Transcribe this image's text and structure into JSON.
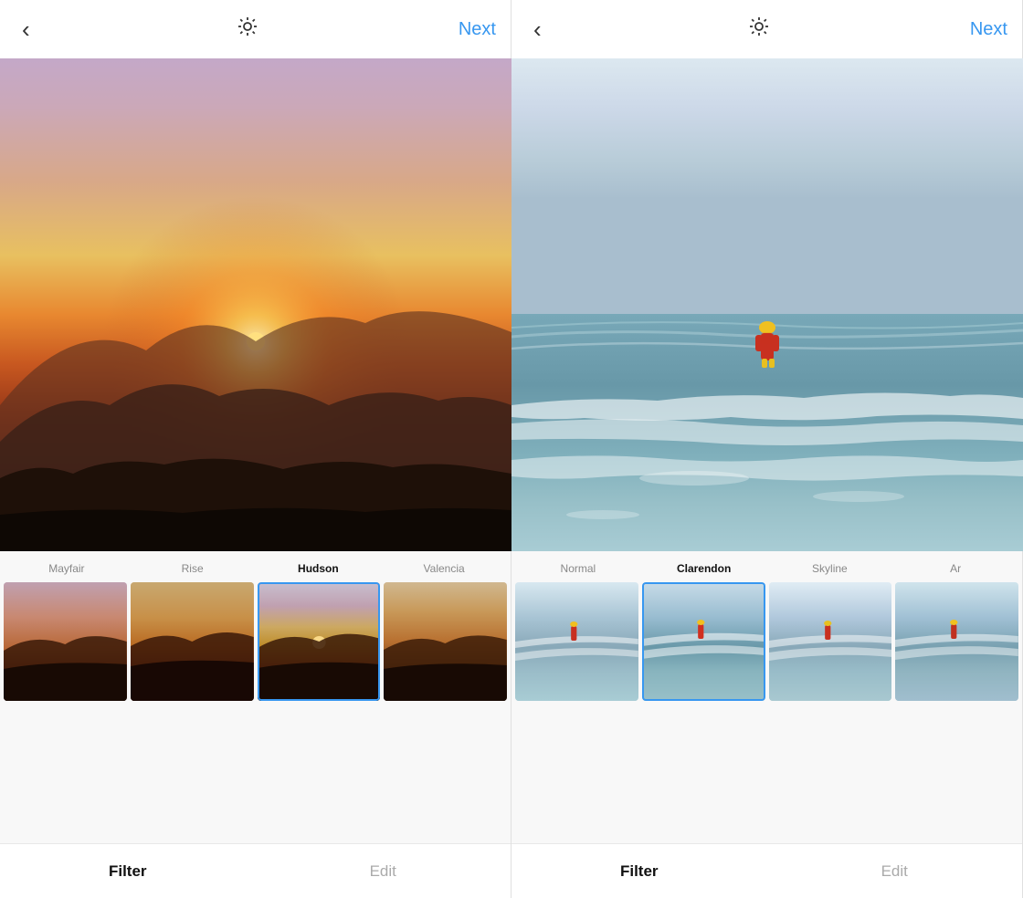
{
  "panels": [
    {
      "id": "left",
      "back_label": "‹",
      "brightness_icon": "☀",
      "next_label": "Next",
      "image_type": "sunset",
      "filters": [
        {
          "name": "Mayfair",
          "active": false,
          "selected": false,
          "thumb_class": "thumb-mayfair"
        },
        {
          "name": "Rise",
          "active": false,
          "selected": false,
          "thumb_class": "thumb-rise"
        },
        {
          "name": "Hudson",
          "active": true,
          "selected": true,
          "thumb_class": "thumb-hudson"
        },
        {
          "name": "Valencia",
          "active": false,
          "selected": false,
          "thumb_class": "thumb-valencia"
        }
      ],
      "tabs": [
        {
          "label": "Filter",
          "active": true
        },
        {
          "label": "Edit",
          "active": false
        }
      ]
    },
    {
      "id": "right",
      "back_label": "‹",
      "brightness_icon": "☀",
      "next_label": "Next",
      "image_type": "beach",
      "filters": [
        {
          "name": "Normal",
          "active": false,
          "selected": false,
          "thumb_class": "thumb-normal"
        },
        {
          "name": "Clarendon",
          "active": true,
          "selected": true,
          "thumb_class": "thumb-clarendon"
        },
        {
          "name": "Skyline",
          "active": false,
          "selected": false,
          "thumb_class": "thumb-skyline"
        },
        {
          "name": "Ar",
          "active": false,
          "selected": false,
          "thumb_class": "thumb-ar"
        }
      ],
      "tabs": [
        {
          "label": "Filter",
          "active": true
        },
        {
          "label": "Edit",
          "active": false
        }
      ]
    }
  ]
}
